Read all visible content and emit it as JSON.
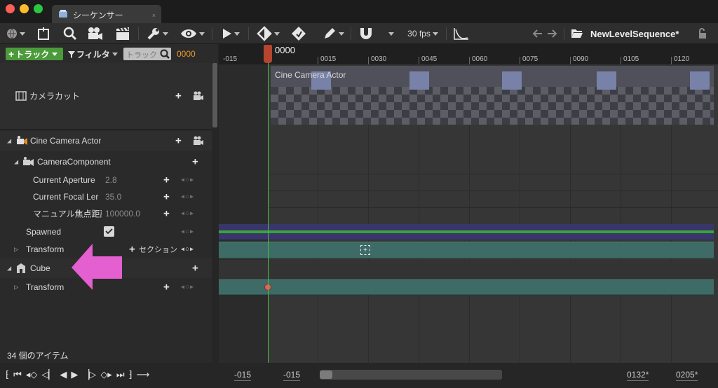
{
  "window": {
    "tab_title": "シーケンサー",
    "tab_close": "×"
  },
  "toolbar": {
    "fps_label": "30 fps",
    "sequence_name": "NewLevelSequence*"
  },
  "filters": {
    "add_track_label": "トラック",
    "filter_label": "フィルタ",
    "search_placeholder": "トラック",
    "current_time": "0000"
  },
  "tree": {
    "camera_cuts": "カメラカット",
    "cine_camera": "Cine Camera Actor",
    "camera_component": "CameraComponent",
    "aperture_label": "Current Aperture",
    "aperture_value": "2.8",
    "focal_label": "Current Focal Ler",
    "focal_value": "35.0",
    "focus_label": "マニュアル焦点距離",
    "focus_value": "100000.0",
    "spawned_label": "Spawned",
    "spawned_checked": true,
    "transform_label": "Transform",
    "section_label": "セクション",
    "cube_label": "Cube",
    "cube_transform_label": "Transform"
  },
  "status": {
    "item_count": "34 個のアイテム"
  },
  "ruler": {
    "playhead": "0000",
    "ticks": [
      "-015",
      "0015",
      "0030",
      "0045",
      "0060",
      "0075",
      "0090",
      "0105",
      "0120"
    ]
  },
  "timeline": {
    "camera_clip_label": "Cine Camera Actor"
  },
  "range": {
    "view_start": "-015",
    "play_start": "-015",
    "play_end": "0132*",
    "view_end": "0205*"
  },
  "colors": {
    "add_track": "#4b9b3a",
    "playhead": "#b5452e",
    "time_readout": "#e89a2c",
    "transform_section": "#3e6b66",
    "spawned_lane": "#38366a",
    "arrow": "#e45fcf"
  }
}
